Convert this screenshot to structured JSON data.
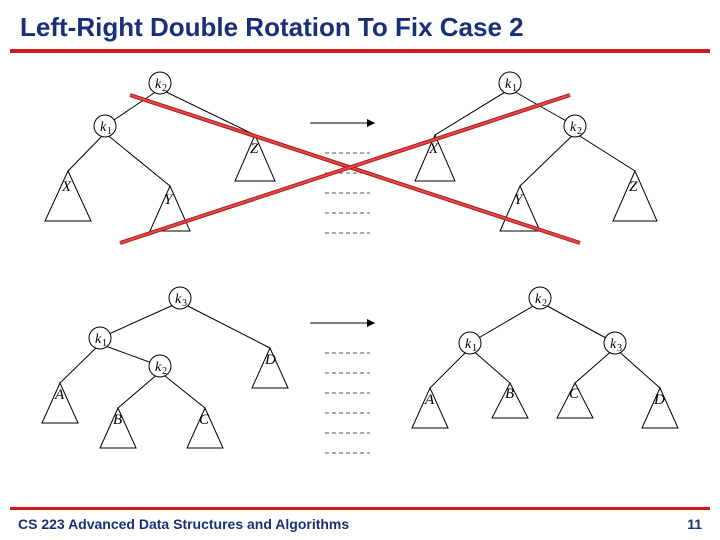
{
  "slide": {
    "title": "Left-Right Double Rotation To Fix Case 2",
    "footer_course": "CS 223 Advanced Data Structures and Algorithms",
    "page_number": "11"
  },
  "diagram_top": {
    "left": {
      "nodes": {
        "root": "k",
        "root_sub": "2",
        "left": "k",
        "left_sub": "1"
      },
      "tris": {
        "x": "X",
        "y": "Y",
        "z": "Z"
      }
    },
    "right": {
      "nodes": {
        "root": "k",
        "root_sub": "1",
        "right": "k",
        "right_sub": "2"
      },
      "tris": {
        "x": "X",
        "y": "Y",
        "z": "Z"
      }
    }
  },
  "diagram_bottom": {
    "left": {
      "nodes": {
        "k1": "k",
        "k1s": "1",
        "k2": "k",
        "k2s": "2",
        "k3": "k",
        "k3s": "3"
      },
      "tris": {
        "a": "A",
        "b": "B",
        "c": "C",
        "d": "D"
      }
    },
    "right": {
      "nodes": {
        "k1": "k",
        "k1s": "1",
        "k2": "k",
        "k2s": "2",
        "k3": "k",
        "k3s": "3"
      },
      "tris": {
        "a": "A",
        "b": "B",
        "c": "C",
        "d": "D"
      }
    }
  }
}
